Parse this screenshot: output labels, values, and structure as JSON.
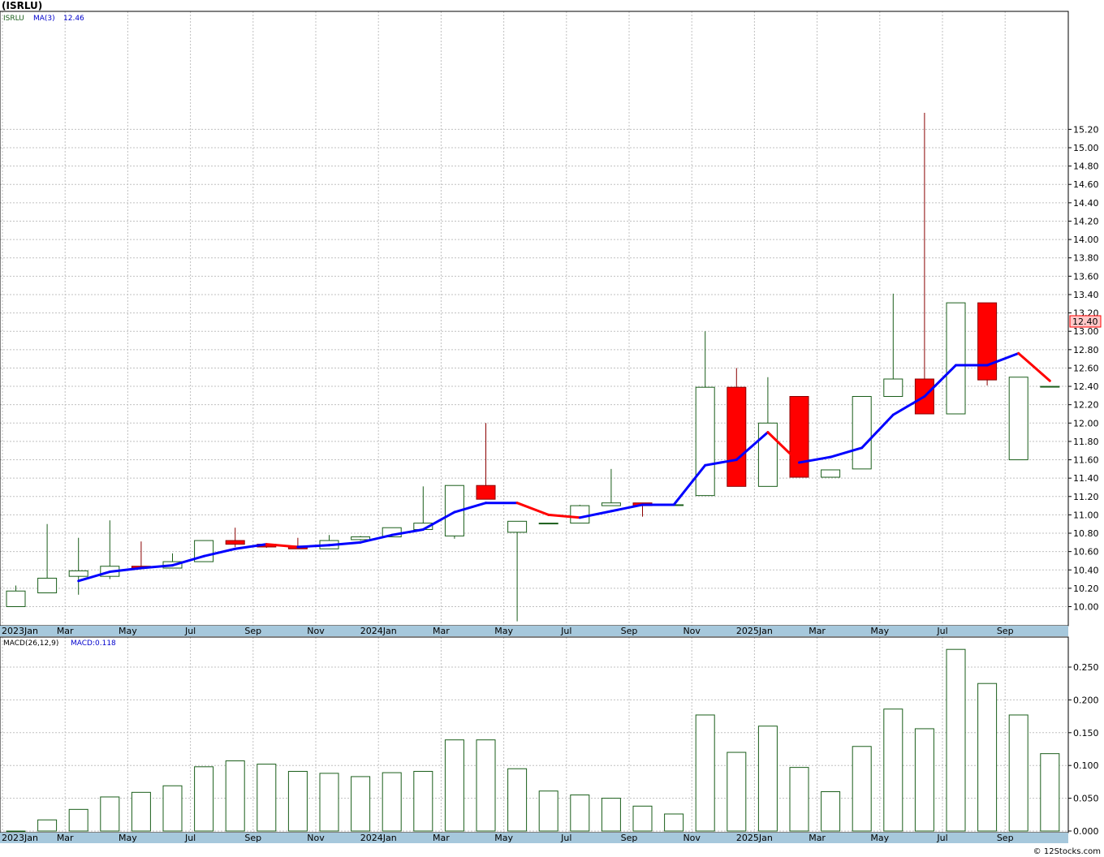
{
  "header": {
    "title": "(ISRLU)"
  },
  "price_panel": {
    "symbol_label": "ISRLU",
    "ma_label": "MA(3)",
    "ma_value": "12.46",
    "last_price_label": "12.40"
  },
  "macd_panel": {
    "label": "MACD(26,12,9)",
    "value_label": "MACD:0.118"
  },
  "footer": {
    "credit": "© 12Stocks.com"
  },
  "colors": {
    "up_stroke": "#1a5e1a",
    "down_fill": "#ff0000",
    "ma_up": "#0000ff",
    "ma_down": "#ff0000",
    "axis_bar": "#a6c8dc",
    "grid": "#c0c0c0"
  },
  "chart_data": [
    {
      "type": "candlestick",
      "ylim": [
        9.85,
        15.35
      ],
      "yticks": [
        "10.00",
        "10.20",
        "10.40",
        "10.60",
        "10.80",
        "11.00",
        "11.20",
        "11.40",
        "11.60",
        "11.80",
        "12.00",
        "12.20",
        "12.40",
        "12.60",
        "12.80",
        "13.00",
        "13.20",
        "13.40",
        "13.60",
        "13.80",
        "14.00",
        "14.20",
        "14.40",
        "14.60",
        "14.80",
        "15.00",
        "15.20"
      ],
      "xticks": [
        "2023Jan",
        "Mar",
        "May",
        "Jul",
        "Sep",
        "Nov",
        "2024Jan",
        "Mar",
        "May",
        "Jul",
        "Sep",
        "Nov",
        "2025Jan",
        "Mar",
        "May",
        "Jul",
        "Sep"
      ],
      "candles": [
        {
          "o": 10.0,
          "h": 10.23,
          "l": 10.0,
          "c": 10.17
        },
        {
          "o": 10.15,
          "h": 10.9,
          "l": 10.15,
          "c": 10.31
        },
        {
          "o": 10.33,
          "h": 10.75,
          "l": 10.13,
          "c": 10.39
        },
        {
          "o": 10.33,
          "h": 10.94,
          "l": 10.3,
          "c": 10.44
        },
        {
          "o": 10.44,
          "h": 10.71,
          "l": 10.41,
          "c": 10.42
        },
        {
          "o": 10.42,
          "h": 10.58,
          "l": 10.42,
          "c": 10.49
        },
        {
          "o": 10.49,
          "h": 10.72,
          "l": 10.49,
          "c": 10.72
        },
        {
          "o": 10.72,
          "h": 10.86,
          "l": 10.65,
          "c": 10.68
        },
        {
          "o": 10.68,
          "h": 10.69,
          "l": 10.64,
          "c": 10.65
        },
        {
          "o": 10.66,
          "h": 10.75,
          "l": 10.63,
          "c": 10.63
        },
        {
          "o": 10.63,
          "h": 10.78,
          "l": 10.63,
          "c": 10.72
        },
        {
          "o": 10.73,
          "h": 10.77,
          "l": 10.72,
          "c": 10.76
        },
        {
          "o": 10.76,
          "h": 10.86,
          "l": 10.76,
          "c": 10.86
        },
        {
          "o": 10.84,
          "h": 11.31,
          "l": 10.84,
          "c": 10.91
        },
        {
          "o": 10.77,
          "h": 11.32,
          "l": 10.74,
          "c": 11.32
        },
        {
          "o": 11.32,
          "h": 12.0,
          "l": 11.17,
          "c": 11.17
        },
        {
          "o": 10.81,
          "h": 10.91,
          "l": 9.84,
          "c": 10.93
        },
        {
          "o": 10.91,
          "h": 10.91,
          "l": 10.91,
          "c": 10.91
        },
        {
          "o": 10.91,
          "h": 11.11,
          "l": 10.91,
          "c": 11.1
        },
        {
          "o": 11.1,
          "h": 11.5,
          "l": 11.1,
          "c": 11.13
        },
        {
          "o": 11.13,
          "h": 11.13,
          "l": 10.98,
          "c": 11.1
        },
        {
          "o": 11.11,
          "h": 11.11,
          "l": 11.11,
          "c": 11.11
        },
        {
          "o": 11.21,
          "h": 13.0,
          "l": 11.21,
          "c": 12.39
        },
        {
          "o": 12.39,
          "h": 12.6,
          "l": 11.31,
          "c": 11.31
        },
        {
          "o": 11.31,
          "h": 12.5,
          "l": 11.31,
          "c": 12.0
        },
        {
          "o": 12.29,
          "h": 12.29,
          "l": 11.41,
          "c": 11.41
        },
        {
          "o": 11.41,
          "h": 11.49,
          "l": 11.41,
          "c": 11.49
        },
        {
          "o": 11.5,
          "h": 12.29,
          "l": 11.5,
          "c": 12.29
        },
        {
          "o": 12.29,
          "h": 13.41,
          "l": 12.29,
          "c": 12.48
        },
        {
          "o": 12.48,
          "h": 15.38,
          "l": 12.1,
          "c": 12.1
        },
        {
          "o": 12.1,
          "h": 13.31,
          "l": 12.1,
          "c": 13.31
        },
        {
          "o": 13.31,
          "h": 13.31,
          "l": 12.41,
          "c": 12.47
        },
        {
          "o": 11.6,
          "h": 12.5,
          "l": 11.6,
          "c": 12.5
        },
        {
          "o": 12.4,
          "h": 12.4,
          "l": 12.4,
          "c": 12.4
        }
      ],
      "ma": [
        null,
        null,
        10.28,
        10.38,
        10.42,
        10.45,
        10.55,
        10.63,
        10.68,
        10.65,
        10.67,
        10.7,
        10.78,
        10.84,
        11.03,
        11.13,
        11.13,
        11.0,
        10.97,
        11.04,
        11.11,
        11.11,
        11.54,
        11.6,
        11.9,
        11.57,
        11.63,
        11.73,
        12.09,
        12.29,
        12.63,
        12.63,
        12.76,
        12.46
      ]
    },
    {
      "type": "bar",
      "title": "MACD(26,12,9)",
      "ylim": [
        0,
        0.28
      ],
      "yticks": [
        "0.000",
        "0.050",
        "0.100",
        "0.150",
        "0.200",
        "0.250"
      ],
      "xticks": [
        "2023Jan",
        "Mar",
        "May",
        "Jul",
        "Sep",
        "Nov",
        "2024Jan",
        "Mar",
        "May",
        "Jul",
        "Sep",
        "Nov",
        "2025Jan",
        "Mar",
        "May",
        "Jul",
        "Sep"
      ],
      "values": [
        0.0,
        0.017,
        0.033,
        0.052,
        0.059,
        0.069,
        0.098,
        0.107,
        0.102,
        0.091,
        0.088,
        0.083,
        0.089,
        0.091,
        0.139,
        0.139,
        0.095,
        0.061,
        0.055,
        0.05,
        0.038,
        0.026,
        0.177,
        0.12,
        0.16,
        0.097,
        0.06,
        0.129,
        0.186,
        0.156,
        0.277,
        0.225,
        0.177,
        0.118
      ]
    }
  ]
}
